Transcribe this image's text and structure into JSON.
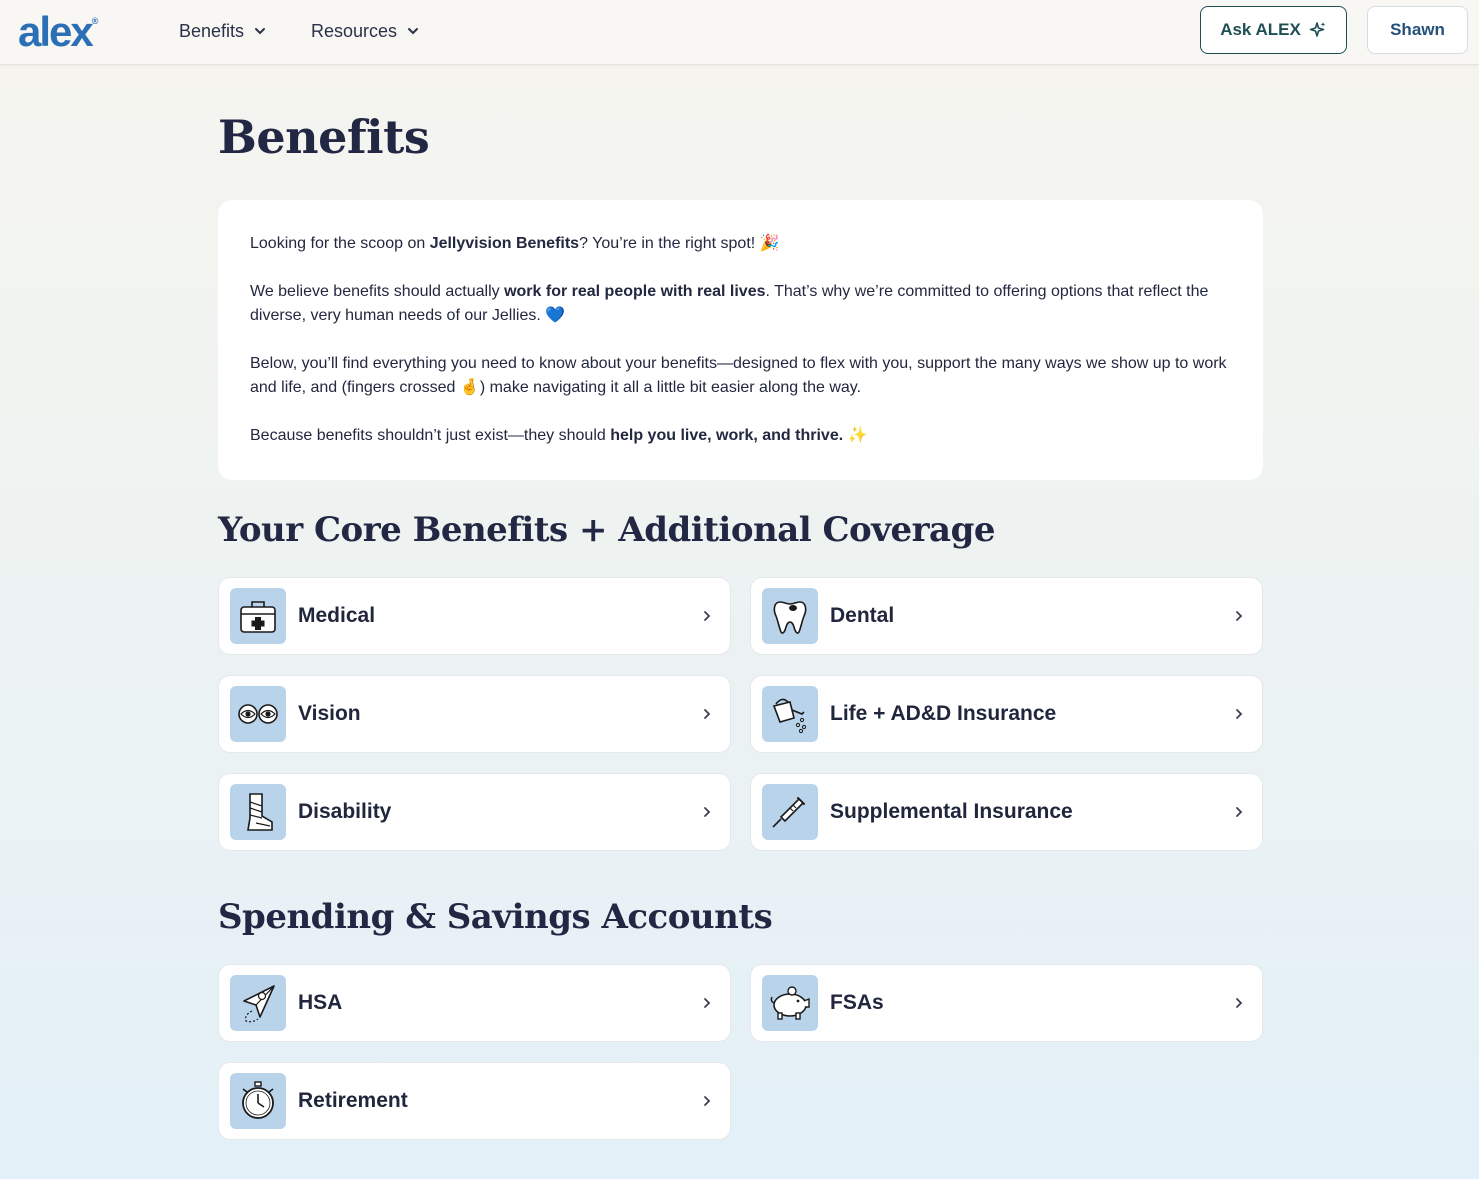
{
  "header": {
    "logo": "alex",
    "logo_mark": "®",
    "nav": [
      {
        "label": "Benefits",
        "icon": "chevron-down-icon"
      },
      {
        "label": "Resources",
        "icon": "chevron-down-icon"
      }
    ],
    "ask_label": "Ask ALEX",
    "ask_icon": "sparkle-icon",
    "user_label": "Shawn"
  },
  "page": {
    "title": "Benefits"
  },
  "intro": {
    "p1_a": "Looking for the scoop on ",
    "p1_b": "Jellyvision Benefits",
    "p1_c": "? You’re in the right spot! 🎉",
    "p2_a": "We believe benefits should actually ",
    "p2_b": "work for real people with real lives",
    "p2_c": ". That’s why we’re committed to offering options that reflect the diverse, very human needs of our Jellies. 💙",
    "p3": "Below, you’ll find everything you need to know about your benefits—designed to flex with you, support the many ways we show up to work and life, and (fingers crossed 🤞) make navigating it all a little bit easier along the way.",
    "p4_a": "Because benefits shouldn’t just exist—they should ",
    "p4_b": "help you live, work, and thrive.",
    "p4_c": " ✨"
  },
  "sections": [
    {
      "title": "Your Core Benefits + Additional Coverage",
      "cards": [
        {
          "label": "Medical",
          "icon": "first-aid-kit-icon"
        },
        {
          "label": "Dental",
          "icon": "tooth-icon"
        },
        {
          "label": "Vision",
          "icon": "eyes-icon"
        },
        {
          "label": "Life + AD&D Insurance",
          "icon": "watering-can-icon"
        },
        {
          "label": "Disability",
          "icon": "leg-cast-icon"
        },
        {
          "label": "Supplemental Insurance",
          "icon": "syringe-icon"
        }
      ]
    },
    {
      "title": "Spending & Savings Accounts",
      "cards": [
        {
          "label": "HSA",
          "icon": "paper-plane-icon"
        },
        {
          "label": "FSAs",
          "icon": "piggy-bank-icon"
        },
        {
          "label": "Retirement",
          "icon": "stopwatch-icon"
        }
      ]
    }
  ],
  "colors": {
    "brand": "#2b6fb6",
    "ask_border": "#1e4f55",
    "icon_tile": "#b9d3ea",
    "heading": "#222844"
  }
}
